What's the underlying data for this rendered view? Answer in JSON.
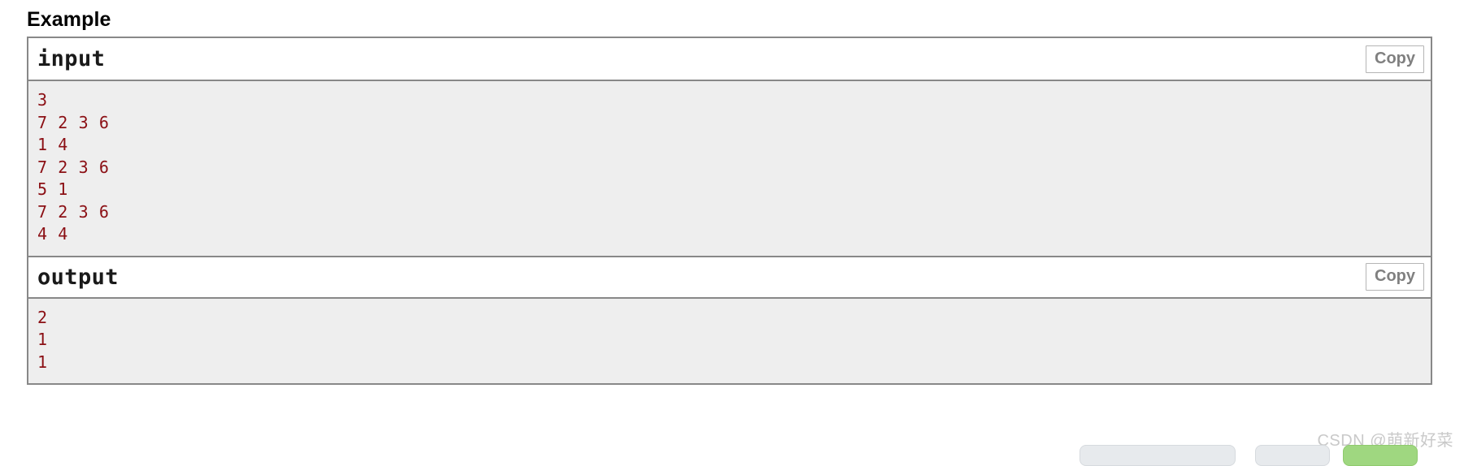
{
  "section": {
    "title": "Example"
  },
  "sample_tests": [
    {
      "label": "input",
      "copy_label": "Copy",
      "lines": [
        "3",
        "7 2 3 6",
        "1 4",
        "7 2 3 6",
        "5 1",
        "7 2 3 6",
        "4 4"
      ]
    },
    {
      "label": "output",
      "copy_label": "Copy",
      "lines": [
        "2",
        "1",
        "1"
      ]
    }
  ],
  "watermark": {
    "text": "CSDN @萌新好菜"
  },
  "colors": {
    "code_text": "#8b0f14",
    "code_background": "#eeeeee",
    "border": "#888888",
    "copy_button_text": "#808080",
    "watermark_text": "#c9c9c9",
    "footer_accent_green": "#9fd780"
  }
}
